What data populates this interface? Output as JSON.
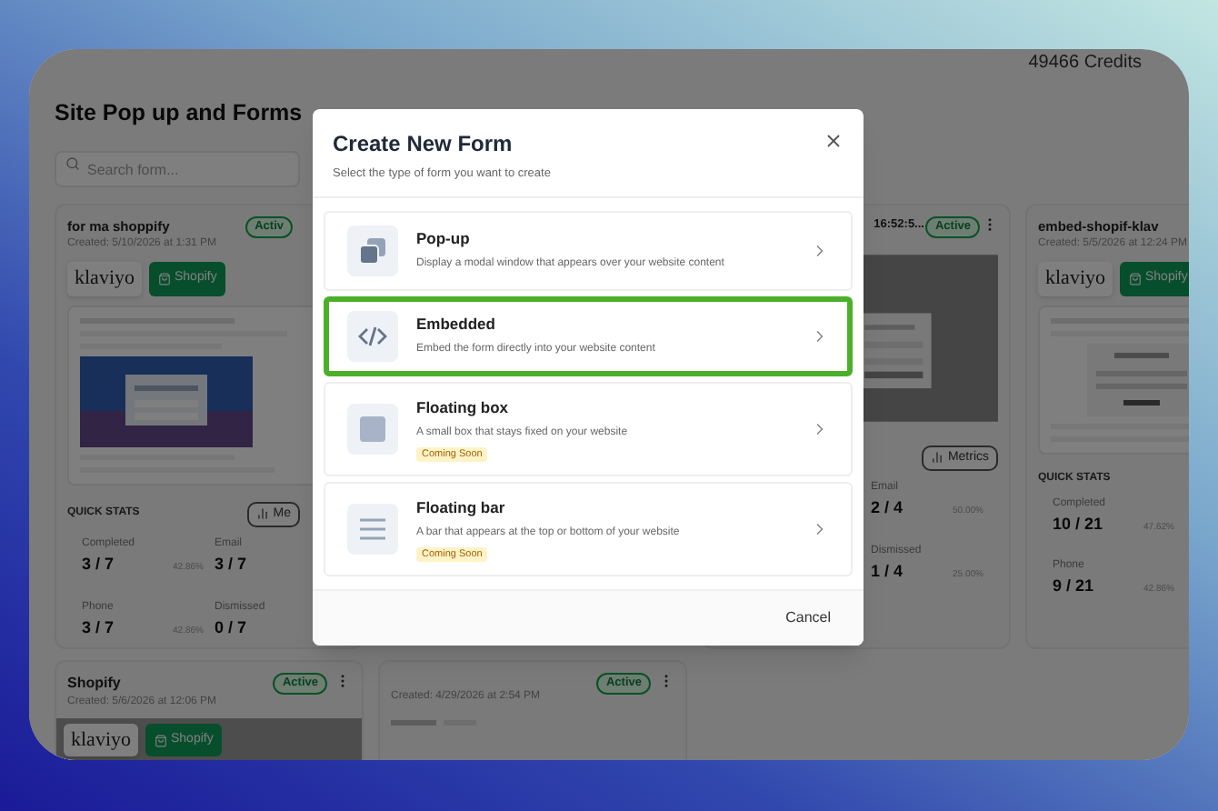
{
  "credits": "49466 Credits",
  "page_title": "Site Pop up and Forms",
  "search": {
    "placeholder": "Search form..."
  },
  "cards": [
    {
      "title": "for ma shoppify",
      "created": "Created: 5/10/2026 at 1:31 PM",
      "status": "Activ",
      "covered_left": false,
      "menu": false,
      "integrations": [
        "klaviyo",
        "Shopify"
      ],
      "stats_label": "QUICK STATS",
      "metrics": "Me",
      "stat_columns": [
        [
          {
            "label": "Completed",
            "value": "3 / 7",
            "percent": "42.86%"
          },
          {
            "label": "Phone",
            "value": "3 / 7",
            "percent": "42.86%"
          }
        ],
        [
          {
            "label": "Email",
            "value": "3 / 7"
          },
          {
            "label": "Dismissed",
            "value": "0 / 7"
          }
        ]
      ]
    },
    {
      "title": "16:52:5...",
      "status": "Active",
      "covered_left": true,
      "menu": true,
      "metrics": "Metrics",
      "stat_columns": [
        [
          {
            "label": "Email",
            "value": "2 / 4",
            "percent": "50.00%"
          },
          {
            "label": "Dismissed",
            "value": "1 / 4",
            "percent": "25.00%"
          }
        ]
      ]
    },
    {
      "title": "embed-shopif-klav",
      "created": "Created: 5/5/2026 at 12:24 PM",
      "integrations": [
        "klaviyo",
        "Shopify"
      ],
      "stats_label": "QUICK STATS",
      "stat_columns": [
        [
          {
            "label": "Completed",
            "value": "10 / 21",
            "percent": "47.62%"
          },
          {
            "label": "Phone",
            "value": "9 / 21",
            "percent": "42.86%"
          }
        ]
      ]
    }
  ],
  "bottom_cards": [
    {
      "title": "Shopify",
      "created": "Created: 5/6/2026 at 12:06 PM",
      "status": "Active",
      "menu": true,
      "integrations": [
        "klaviyo",
        "Shopify"
      ]
    },
    {
      "created": "Created: 4/29/2026 at 2:54 PM",
      "status": "Active",
      "menu": true
    }
  ],
  "modal": {
    "title": "Create New Form",
    "subtitle": "Select the type of form you want to create",
    "options": [
      {
        "kind": "popup",
        "title": "Pop-up",
        "description": "Display a modal window that appears over your website content",
        "selected": false
      },
      {
        "kind": "code",
        "title": "Embedded",
        "description": "Embed the form directly into your website content",
        "selected": true
      },
      {
        "kind": "box",
        "title": "Floating box",
        "description": "A small box that stays fixed on your website",
        "badge": "Coming Soon",
        "selected": false
      },
      {
        "kind": "bar",
        "title": "Floating bar",
        "description": "A bar that appears at the top or bottom of your website",
        "badge": "Coming Soon",
        "selected": false
      }
    ],
    "cancel": "Cancel"
  }
}
